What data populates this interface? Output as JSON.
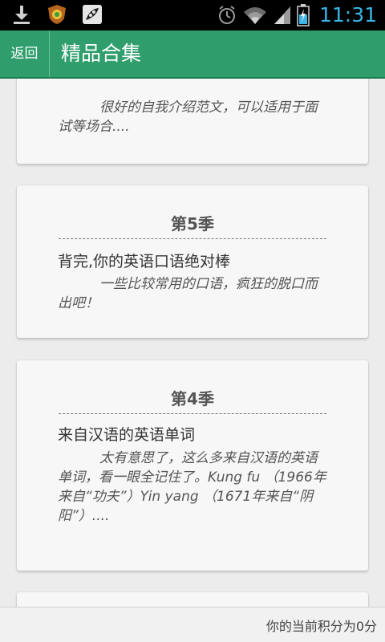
{
  "status_bar": {
    "time": "11:31",
    "icons": [
      "download-icon",
      "shield-app-icon",
      "app-icon",
      "alarm-icon",
      "wifi-icon",
      "signal-icon",
      "battery-icon"
    ]
  },
  "header": {
    "back_label": "返回",
    "title": "精品合集"
  },
  "cards": [
    {
      "title": "",
      "subtitle": "",
      "description": "很好的自我介绍范文，可以适用于面试等场合...."
    },
    {
      "title": "第5季",
      "subtitle": "背完,你的英语口语绝对棒",
      "description": "一些比较常用的口语，疯狂的脱口而出吧！"
    },
    {
      "title": "第4季",
      "subtitle": "来自汉语的英语单词",
      "description": "太有意思了，这么多来自汉语的英语单词，看一眼全记住了。Kung fu （1966年来自“功夫”）Yin yang （1671年来自“阴阳”）...."
    }
  ],
  "footer": {
    "score_text": "你的当前积分为0分"
  },
  "colors": {
    "header_bg": "#2f9e6c",
    "status_time": "#39b6e6"
  }
}
